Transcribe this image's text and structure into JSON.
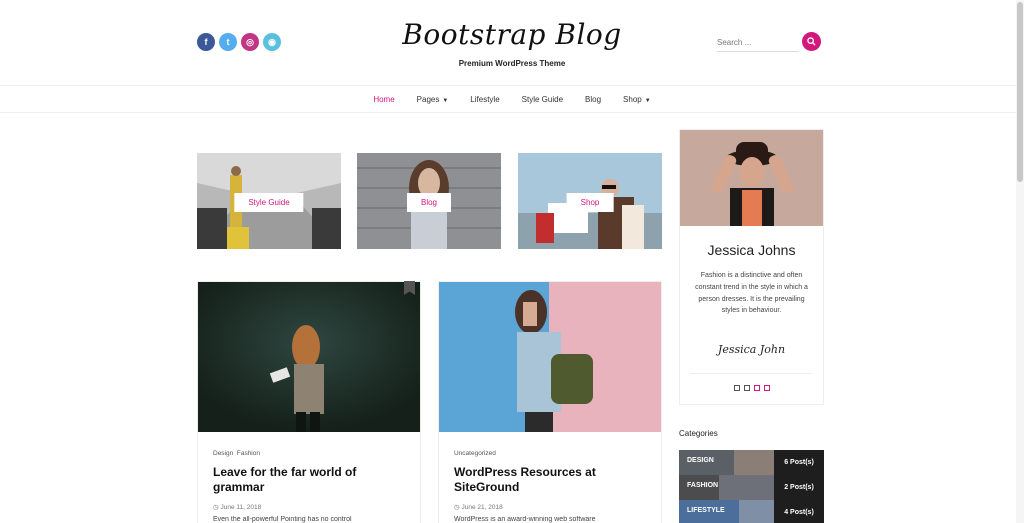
{
  "header": {
    "logo": "Bootstrap Blog",
    "tagline": "Premium WordPress Theme",
    "social": [
      {
        "icon": "facebook-icon",
        "glyph": "f",
        "color": "#3b5998"
      },
      {
        "icon": "twitter-icon",
        "glyph": "t",
        "color": "#55acee"
      },
      {
        "icon": "instagram-icon",
        "glyph": "◎",
        "color": "#c13584"
      },
      {
        "icon": "dribbble-icon",
        "glyph": "◉",
        "color": "#5bc0de"
      }
    ],
    "search_placeholder": "Search ..."
  },
  "nav": {
    "items": [
      {
        "label": "Home",
        "active": true
      },
      {
        "label": "Pages",
        "dropdown": true
      },
      {
        "label": "Lifestyle"
      },
      {
        "label": "Style Guide"
      },
      {
        "label": "Blog"
      },
      {
        "label": "Shop",
        "dropdown": true
      }
    ]
  },
  "promo": [
    {
      "label": "Style Guide"
    },
    {
      "label": "Blog"
    },
    {
      "label": "Shop"
    }
  ],
  "posts": [
    {
      "cats": [
        "Design",
        "Fashion"
      ],
      "title": "Leave for the far world of grammar",
      "date": "June 11, 2018",
      "excerpt": "Even the all-powerful Pointing has no control"
    },
    {
      "cats": [
        "Uncategorized"
      ],
      "title": "WordPress Resources at SiteGround",
      "date": "June 21, 2018",
      "excerpt": "WordPress is an award-winning web software"
    }
  ],
  "author": {
    "name": "Jessica Johns",
    "bio": "Fashion is a distinctive and often constant trend in the style in which a person dresses. It is the prevailing styles in behaviour.",
    "signature": "Jessica John"
  },
  "categories": {
    "heading": "Categories",
    "items": [
      {
        "name": "DESIGN",
        "count": "6 Post(s)"
      },
      {
        "name": "FASHION",
        "count": "2 Post(s)"
      },
      {
        "name": "LIFESTYLE",
        "count": "4 Post(s)"
      }
    ]
  },
  "colors": {
    "accent": "#d1187d"
  }
}
